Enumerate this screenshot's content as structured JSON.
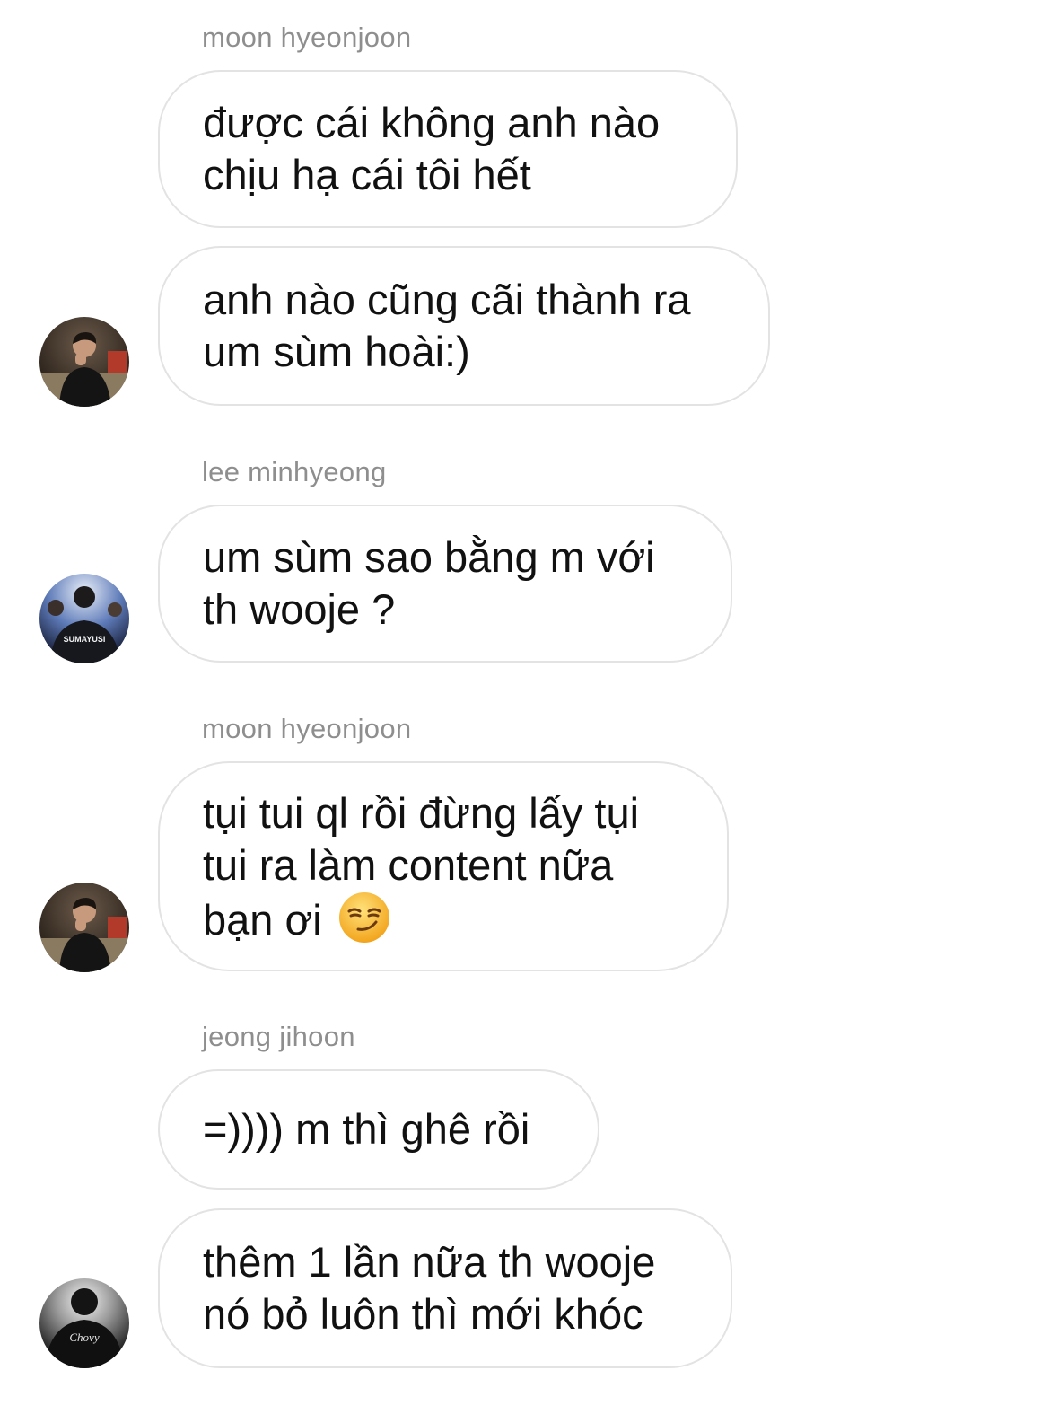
{
  "messages": [
    {
      "sender": "moon hyeonjoon",
      "bubbles": [
        {
          "text": "được cái không anh nào\nchịu hạ cái tôi hết"
        },
        {
          "text": "anh nào cũng cãi thành ra\num sùm hoài:)"
        }
      ],
      "avatar": "avatar-moon"
    },
    {
      "sender": "lee minhyeong",
      "bubbles": [
        {
          "text": "um sùm sao bằng m với\nth wooje ?"
        }
      ],
      "avatar": "avatar-lee",
      "avatar_text": "SUMAYUSI"
    },
    {
      "sender": "moon hyeonjoon",
      "bubbles": [
        {
          "text": "tụi tui ql rồi đừng lấy tụi\ntui ra làm content nữa\nbạn ơi",
          "emoji": "smirking-face-emoji"
        }
      ],
      "avatar": "avatar-moon"
    },
    {
      "sender": "jeong jihoon",
      "bubbles": [
        {
          "text": "=)))) m thì ghê rồi"
        },
        {
          "text": "thêm 1 lần nữa th wooje\nnó bỏ luôn thì mới khóc"
        }
      ],
      "avatar": "avatar-jeong",
      "avatar_text": "Chovy"
    }
  ],
  "colors": {
    "bubble_border": "#e3e3e3",
    "sender_name": "#8e8e8e",
    "message_text": "#111111",
    "background": "#ffffff"
  }
}
